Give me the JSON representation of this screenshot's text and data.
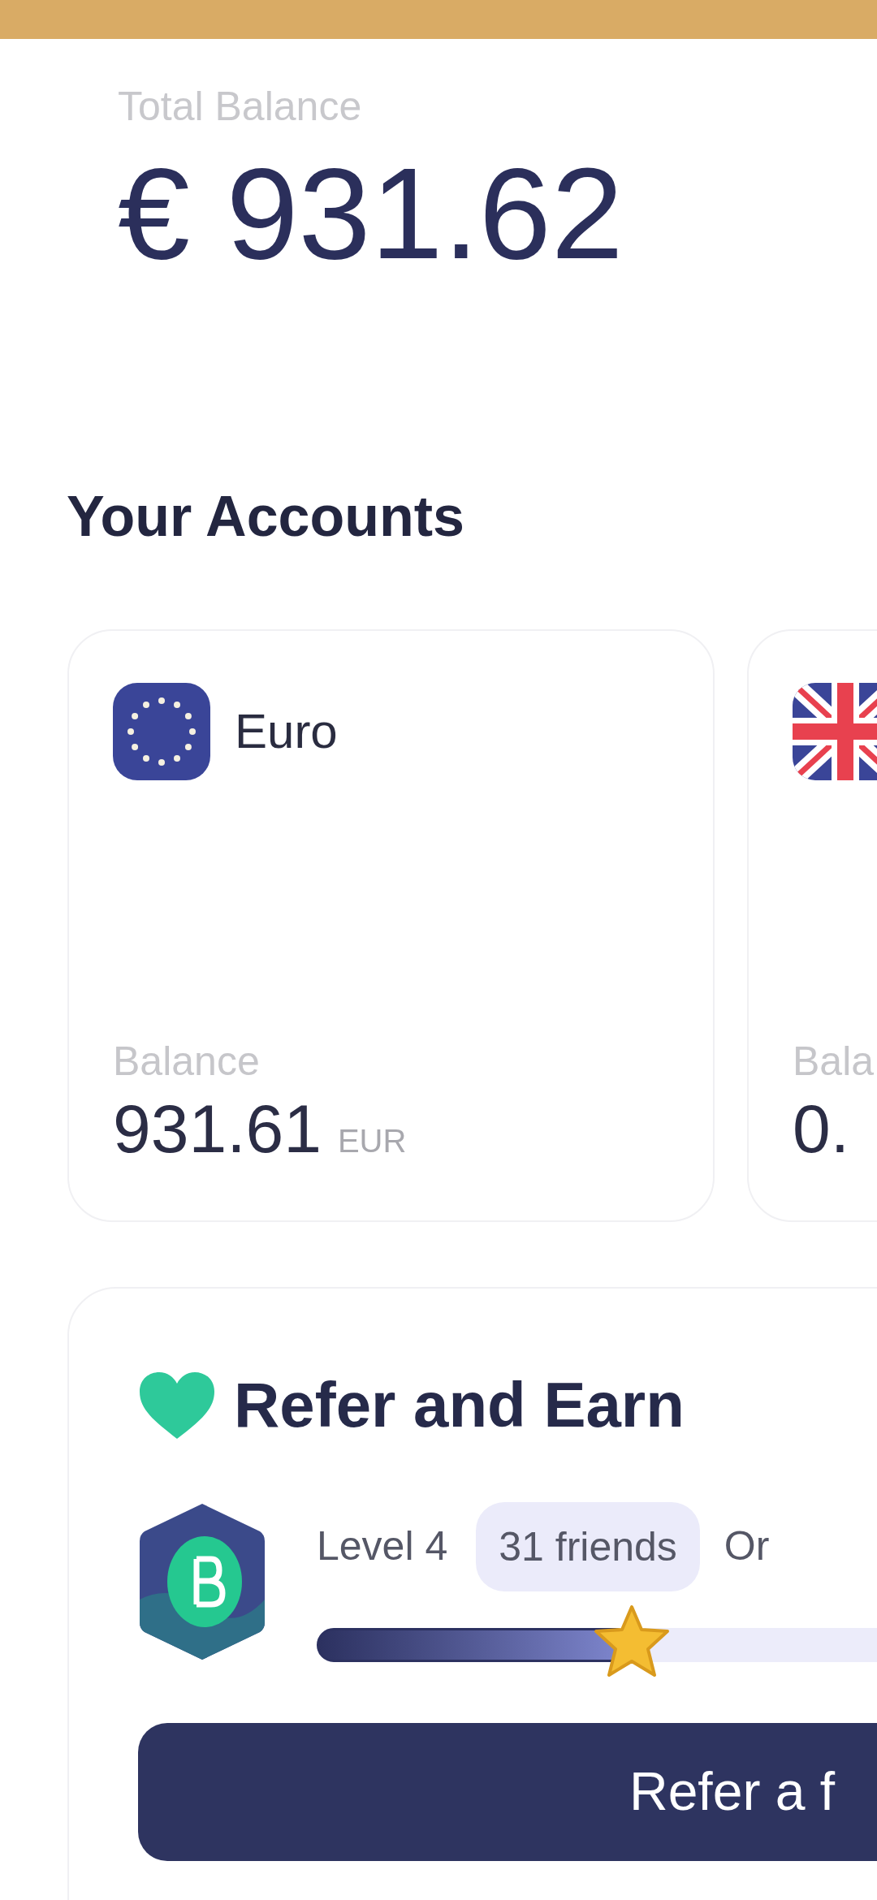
{
  "total_balance": {
    "label": "Total Balance",
    "amount": "€ 931.62"
  },
  "accounts_section": {
    "title": "Your Accounts",
    "accounts": [
      {
        "kind": "eu",
        "name": "Euro",
        "balance_label": "Balance",
        "amount": "931.61",
        "currency": "EUR"
      },
      {
        "kind": "uk",
        "balance_label": "Bala",
        "amount": "0."
      }
    ]
  },
  "referral": {
    "title": "Refer and Earn",
    "level_label": "Level 4",
    "friends": "31 friends",
    "next_label": "Or",
    "level": 0.56,
    "button": "Refer a f"
  }
}
